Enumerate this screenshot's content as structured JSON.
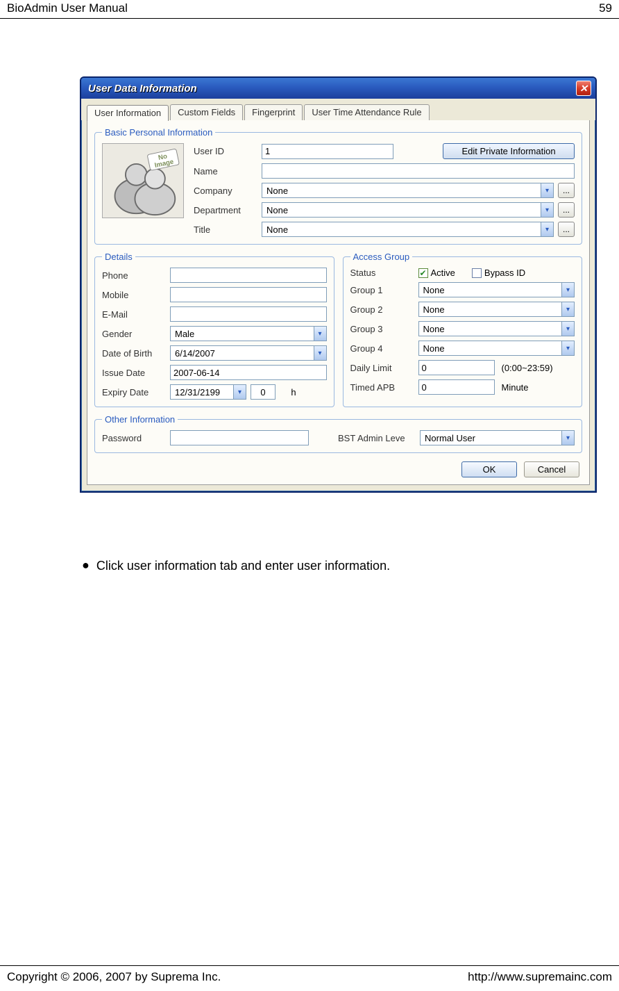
{
  "header": {
    "left": "BioAdmin User Manual",
    "right": "59"
  },
  "footer": {
    "left": "Copyright © 2006, 2007 by Suprema Inc.",
    "right": "http://www.supremainc.com"
  },
  "dialog": {
    "title": "User Data Information",
    "close_glyph": "✕",
    "tabs": [
      "User Information",
      "Custom Fields",
      "Fingerprint",
      "User Time Attendance Rule"
    ],
    "basic": {
      "legend": "Basic Personal Information",
      "no_image_text": "No\nImage",
      "user_id_label": "User ID",
      "user_id_value": "1",
      "edit_private_btn": "Edit Private Information",
      "name_label": "Name",
      "name_value": "",
      "company_label": "Company",
      "company_value": "None",
      "department_label": "Department",
      "department_value": "None",
      "title_label": "Title",
      "title_value": "None",
      "ellipsis": "..."
    },
    "details": {
      "legend": "Details",
      "phone_label": "Phone",
      "phone_value": "",
      "mobile_label": "Mobile",
      "mobile_value": "",
      "email_label": "E-Mail",
      "email_value": "",
      "gender_label": "Gender",
      "gender_value": "Male",
      "dob_label": "Date of Birth",
      "dob_value": "6/14/2007",
      "issue_label": "Issue Date",
      "issue_value": "2007-06-14",
      "expiry_label": "Expiry Date",
      "expiry_value": "12/31/2199",
      "expiry_h_value": "0",
      "expiry_h_unit": "h"
    },
    "access": {
      "legend": "Access Group",
      "status_label": "Status",
      "active_label": "Active",
      "bypass_label": "Bypass ID",
      "group1_label": "Group 1",
      "group1_value": "None",
      "group2_label": "Group 2",
      "group2_value": "None",
      "group3_label": "Group 3",
      "group3_value": "None",
      "group4_label": "Group 4",
      "group4_value": "None",
      "daily_label": "Daily Limit",
      "daily_value": "0",
      "daily_hint": "(0:00~23:59)",
      "apb_label": "Timed APB",
      "apb_value": "0",
      "apb_unit": "Minute"
    },
    "other": {
      "legend": "Other Information",
      "password_label": "Password",
      "password_value": "",
      "bst_label": "BST Admin Leve",
      "bst_value": "Normal User"
    },
    "ok_btn": "OK",
    "cancel_btn": "Cancel"
  },
  "instruction_text": "Click user information tab and enter user information.",
  "dd_glyph": "▾",
  "check_glyph": "✔"
}
